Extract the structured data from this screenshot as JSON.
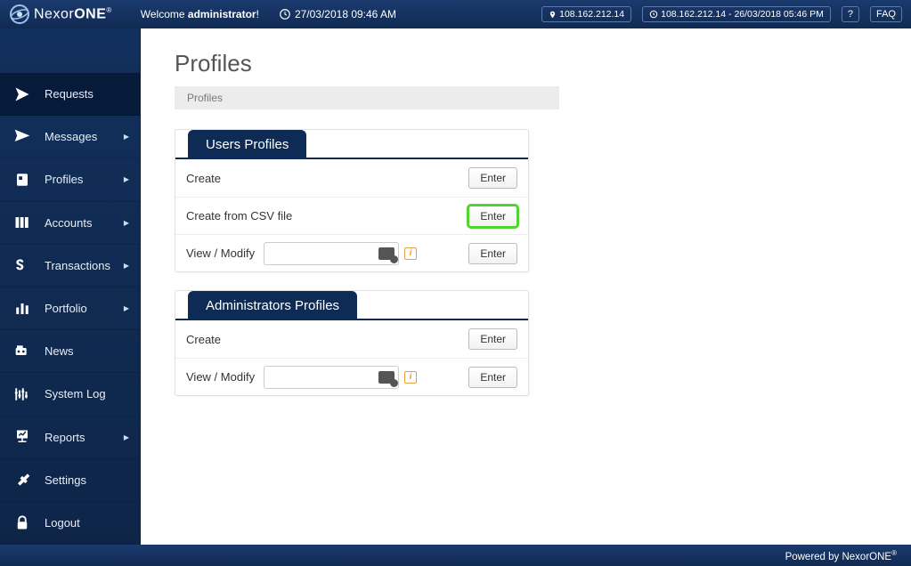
{
  "brand": {
    "name_a": "Nexor",
    "name_b": "ONE",
    "reg": "®"
  },
  "header": {
    "welcome_prefix": "Welcome ",
    "welcome_user": "administrator",
    "welcome_suffix": "!",
    "datetime": "27/03/2018 09:46 AM",
    "ip_current": "108.162.212.14",
    "ip_last": "108.162.212.14 - 26/03/2018 05:46 PM",
    "help": "?",
    "faq": "FAQ"
  },
  "sidebar": {
    "items": [
      {
        "label": "Requests",
        "has_sub": false
      },
      {
        "label": "Messages",
        "has_sub": true
      },
      {
        "label": "Profiles",
        "has_sub": true
      },
      {
        "label": "Accounts",
        "has_sub": true
      },
      {
        "label": "Transactions",
        "has_sub": true
      },
      {
        "label": "Portfolio",
        "has_sub": true
      },
      {
        "label": "News",
        "has_sub": false
      },
      {
        "label": "System Log",
        "has_sub": false
      },
      {
        "label": "Reports",
        "has_sub": true
      },
      {
        "label": "Settings",
        "has_sub": false
      },
      {
        "label": "Logout",
        "has_sub": false
      }
    ]
  },
  "page": {
    "title": "Profiles",
    "breadcrumb": "Profiles"
  },
  "panels": {
    "users": {
      "title": "Users Profiles",
      "rows": {
        "create": "Create",
        "csv": "Create from CSV file",
        "view": "View / Modify"
      }
    },
    "admins": {
      "title": "Administrators Profiles",
      "rows": {
        "create": "Create",
        "view": "View / Modify"
      }
    }
  },
  "buttons": {
    "enter": "Enter"
  },
  "footer": {
    "text": "Powered by NexorONE",
    "reg": "®"
  }
}
